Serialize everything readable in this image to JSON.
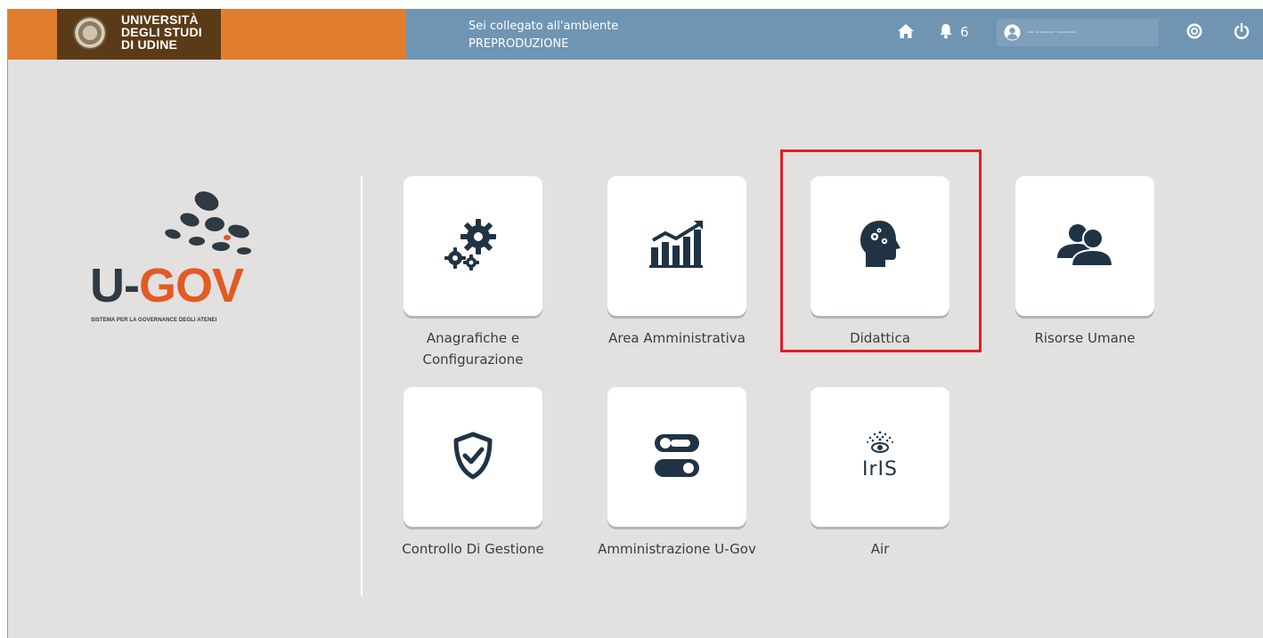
{
  "header": {
    "university_lines": [
      "UNIVERSITÀ",
      "DEGLI STUDI",
      "DI UDINE"
    ],
    "env_line1": "Sei collegato all'ambiente",
    "env_line2": "PREPRODUZIONE",
    "notification_count": "6",
    "user_name": "-- ------ ------",
    "icons": [
      "home-icon",
      "bell-icon",
      "user-icon",
      "help-icon",
      "power-icon"
    ]
  },
  "logo": {
    "brand_u": "U-",
    "brand_gov": "GOV",
    "subtitle": "SISTEMA PER LA GOVERNANCE DEGLI ATENEI"
  },
  "modules": [
    {
      "label": "Anagrafiche e Configurazione",
      "icon": "gears-icon"
    },
    {
      "label": "Area Amministrativa",
      "icon": "chart-icon"
    },
    {
      "label": "Didattica",
      "icon": "brain-head-icon",
      "highlighted": true
    },
    {
      "label": "Risorse Umane",
      "icon": "users-icon"
    },
    {
      "label": "Controllo Di Gestione",
      "icon": "shield-check-icon"
    },
    {
      "label": "Amministrazione U-Gov",
      "icon": "toggles-icon"
    },
    {
      "label": "Air",
      "icon": "iris-logo-icon"
    }
  ],
  "colors": {
    "header_bar": "#6f95b3",
    "brand_orange": "#e07e2e",
    "brand_brown": "#5b3b17",
    "icon_dark": "#1f3344",
    "highlight_red": "#e51c25",
    "logo_orange": "#e25a24"
  }
}
